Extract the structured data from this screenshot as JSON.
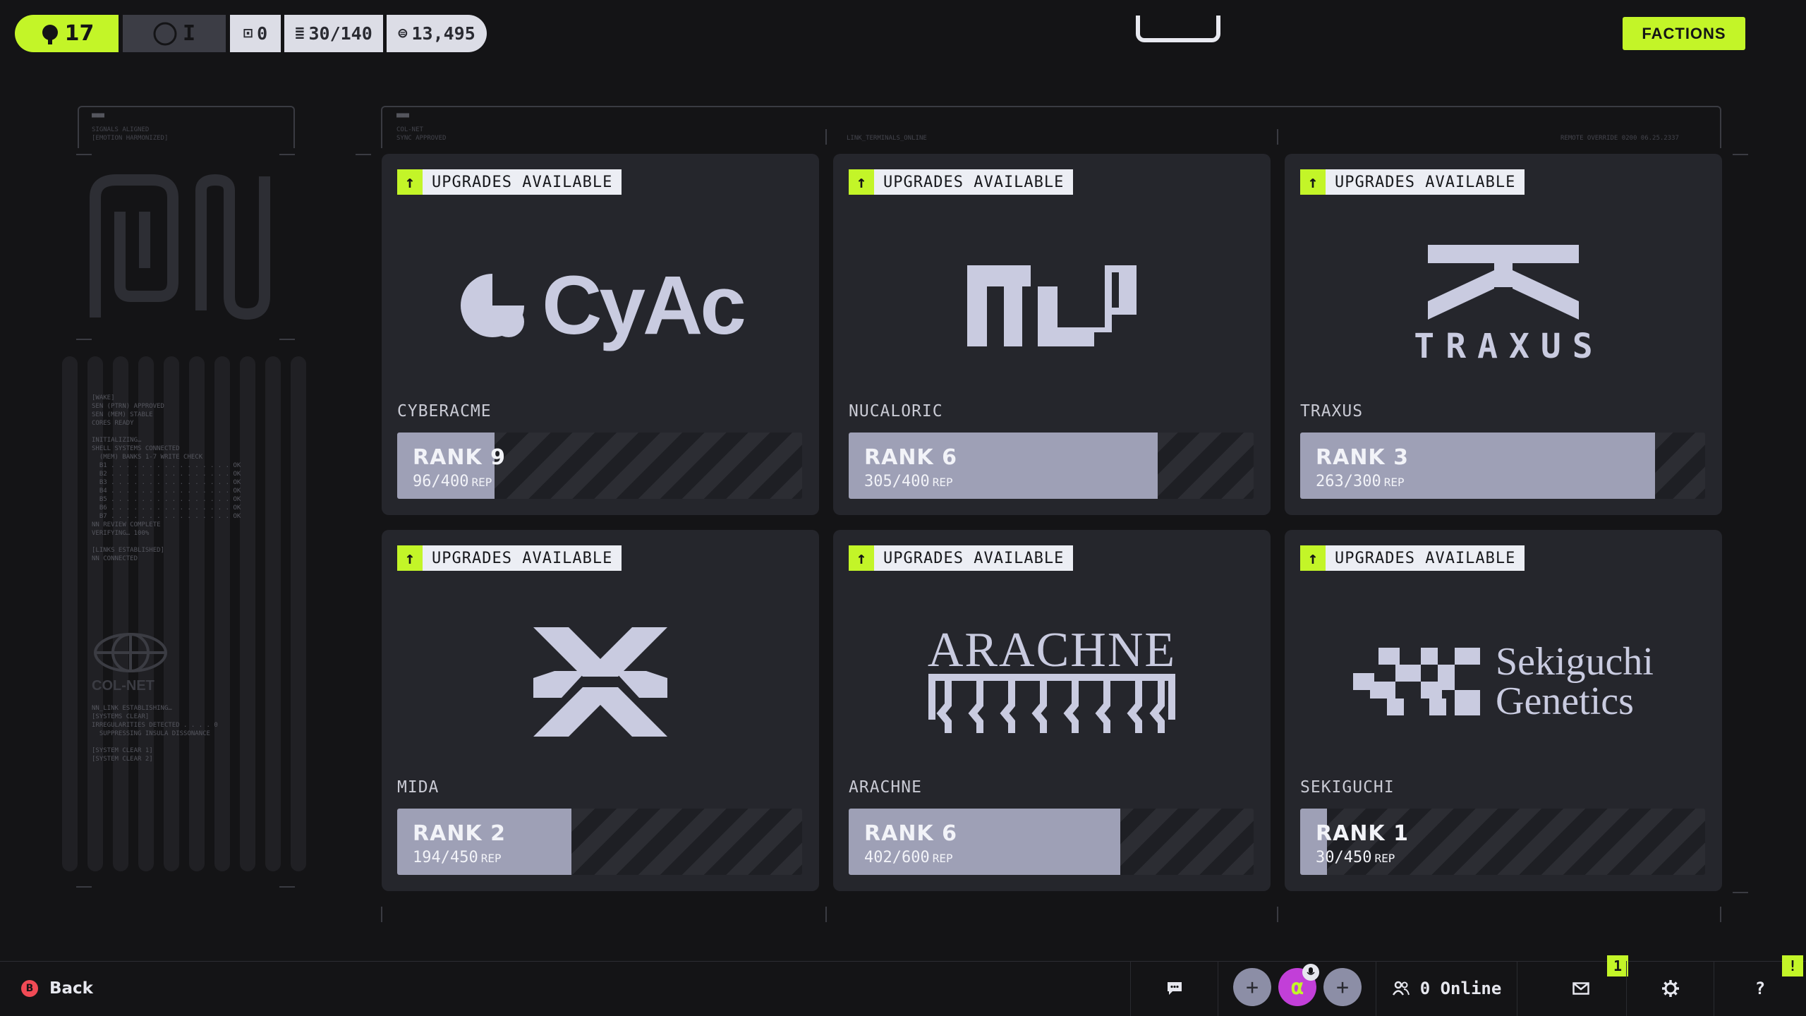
{
  "topbar": {
    "level": "17",
    "prestige": "I",
    "stat_a": "0",
    "stat_b": "30/140",
    "stat_c": "13,495",
    "factions_label": "FACTIONS"
  },
  "left_panel": {
    "header_lines": "SIGNALS ALIGNED\n[EMOTION HARMONIZED]",
    "log_lines": "[WAKE]\nSEN (PTRN) APPROVED\nSEN (MEM) STABLE\nCORES READY\n\nINITIALIZING…\nSHELL SYSTEMS CONNECTED\n  (MEM) BANKS 1-7 WRITE CHECK\n  B1 . . . . . . . . . . . . . . . . OK\n  B2 . . . . . . . . . . . . . . . . OK\n  B3 . . . . . . . . . . . . . . . . OK\n  B4 . . . . . . . . . . . . . . . . OK\n  B5 . . . . . . . . . . . . . . . . OK\n  B6 . . . . . . . . . . . . . . . . OK\n  B7 . . . . . . . . . . . . . . . . OK\nNN REVIEW COMPLETE\nVERIFYING… 100%\n\n[LINKS ESTABLISHED]\nNN CONNECTED",
    "colnet_label": "COL-NET",
    "log2_lines": "NN_LINK ESTABLISHING…\n[SYSTEMS CLEAR]\nIRREGULARITIES DETECTED . . . . 0\n  SUPPRESSING INSULA DISSONANCE\n\n[SYSTEM CLEAR 1]\n[SYSTEM CLEAR 2]"
  },
  "frame_labels": {
    "a": "COL-NET\nSYNC APPROVED",
    "b": "LINK_TERMINALS_ONLINE",
    "c": "REMOTE OVERRIDE 0200 06.25.2337"
  },
  "badge_label": "UPGRADES AVAILABLE",
  "rep_unit": "REP",
  "factions": [
    {
      "name": "CYBERACME",
      "logo": "CyAc",
      "rank": "RANK 9",
      "rep": "96/400",
      "progress": 0.24
    },
    {
      "name": "NUCALORIC",
      "logo": "nucaloric-logo",
      "rank": "RANK 6",
      "rep": "305/400",
      "progress": 0.7625
    },
    {
      "name": "TRAXUS",
      "logo": "TRAXUS",
      "rank": "RANK 3",
      "rep": "263/300",
      "progress": 0.877
    },
    {
      "name": "MIDA",
      "logo": "mida-logo",
      "rank": "RANK 2",
      "rep": "194/450",
      "progress": 0.43
    },
    {
      "name": "ARACHNE",
      "logo": "ARACHNE",
      "rank": "RANK 6",
      "rep": "402/600",
      "progress": 0.67
    },
    {
      "name": "SEKIGUCHI",
      "logo_line1": "Sekiguchi",
      "logo_line2": "Genetics",
      "rank": "RANK 1",
      "rep": "30/450",
      "progress": 0.067
    }
  ],
  "bottombar": {
    "back_label": "Back",
    "back_key": "B",
    "online_label": "0 Online",
    "mail_count": "1",
    "alert_mark": "!",
    "help_label": "?"
  },
  "colors": {
    "accent": "#c3f528",
    "card_bg": "#25262c",
    "rank_fill": "#9ea0b6",
    "logo": "#c9cbe0"
  }
}
